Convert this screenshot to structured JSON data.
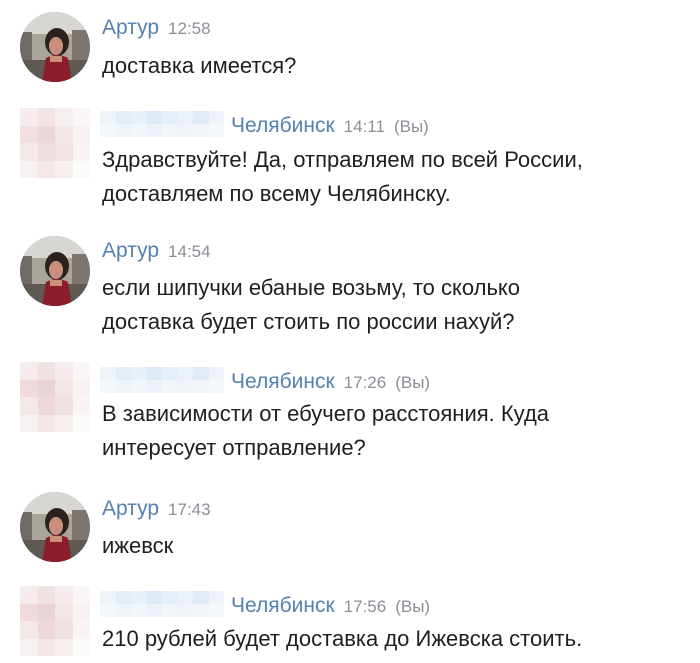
{
  "messages": [
    {
      "author": "Артур",
      "time": "12:58",
      "you": "",
      "text": "доставка имеется?"
    },
    {
      "author": "Челябинск",
      "time": "14:11",
      "you": "(Вы)",
      "text": "Здравствуйте! Да, отправляем по всей России,\nдоставляем по всему Челябинску."
    },
    {
      "author": "Артур",
      "time": "14:54",
      "you": "",
      "text": "если шипучки ебаные возьму, то сколько\nдоставка будет стоить по россии нахуй?"
    },
    {
      "author": "Челябинск",
      "time": "17:26",
      "you": "(Вы)",
      "text": "В зависимости от ебучего расстояния. Куда\nинтересует отправление?"
    },
    {
      "author": "Артур",
      "time": "17:43",
      "you": "",
      "text": "ижевск"
    },
    {
      "author": "Челябинск",
      "time": "17:56",
      "you": "(Вы)",
      "text": "210 рублей будет доставка до Ижевска стоить."
    }
  ]
}
